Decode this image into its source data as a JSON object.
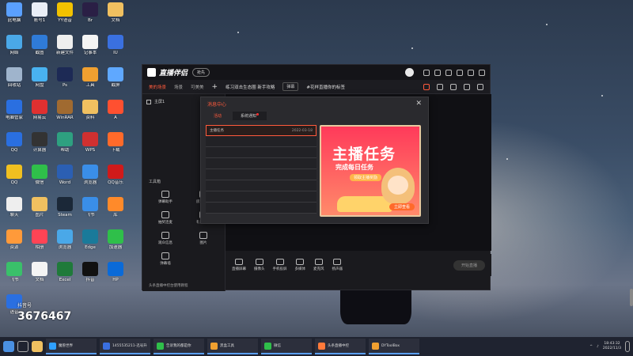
{
  "desktop_icons": [
    {
      "label": "此电脑",
      "color": "#5aa0ff"
    },
    {
      "label": "账号1",
      "color": "#e9eef7"
    },
    {
      "label": "YY语音",
      "color": "#f2c200"
    },
    {
      "label": "Br",
      "color": "#2a1f45"
    },
    {
      "label": "文档",
      "color": "#f0c060"
    },
    {
      "label": "网络",
      "color": "#4aa8e8"
    },
    {
      "label": "截图",
      "color": "#2f7bd8"
    },
    {
      "label": "新建文件",
      "color": "#eeeeee"
    },
    {
      "label": "记事本",
      "color": "#f4f4f4"
    },
    {
      "label": "IU",
      "color": "#3a70e0"
    },
    {
      "label": "回收站",
      "color": "#9fb4cc"
    },
    {
      "label": "网盘",
      "color": "#49b2f0"
    },
    {
      "label": "Ps",
      "color": "#1d2a55"
    },
    {
      "label": "工具",
      "color": "#f0a030"
    },
    {
      "label": "截屏",
      "color": "#5fa8ff"
    },
    {
      "label": "电脑管家",
      "color": "#2a6fe0"
    },
    {
      "label": "网易云",
      "color": "#e03030"
    },
    {
      "label": "WinRAR",
      "color": "#a06a30"
    },
    {
      "label": "资料",
      "color": "#f0c060"
    },
    {
      "label": "A",
      "color": "#ff5030"
    },
    {
      "label": "QQ",
      "color": "#2a6fe0"
    },
    {
      "label": "计算器",
      "color": "#333333"
    },
    {
      "label": "帮助",
      "color": "#2ea080"
    },
    {
      "label": "WPS",
      "color": "#d03030"
    },
    {
      "label": "下载",
      "color": "#ff6a2a"
    },
    {
      "label": "QQ",
      "color": "#f0c020"
    },
    {
      "label": "微信",
      "color": "#2fbf4a"
    },
    {
      "label": "Word",
      "color": "#2b5fb3"
    },
    {
      "label": "浏览器",
      "color": "#3a8ee8"
    },
    {
      "label": "QQ音乐",
      "color": "#d01a1a"
    },
    {
      "label": "聊天",
      "color": "#eeeeee"
    },
    {
      "label": "图片",
      "color": "#f0c060"
    },
    {
      "label": "Steam",
      "color": "#1b2838"
    },
    {
      "label": "飞书",
      "color": "#3a8ee8"
    },
    {
      "label": "库",
      "color": "#ff8a2a"
    },
    {
      "label": "资源",
      "color": "#ff9a3a"
    },
    {
      "label": "相册",
      "color": "#f45"
    },
    {
      "label": "浏览器",
      "color": "#4aa8e8"
    },
    {
      "label": "Edge",
      "color": "#1a7a9a"
    },
    {
      "label": "加速器",
      "color": "#2fbf4a"
    },
    {
      "label": "飞书",
      "color": "#3ac06a"
    },
    {
      "label": "文档",
      "color": "#f4f4f4"
    },
    {
      "label": "Excel",
      "color": "#1f7a3a"
    },
    {
      "label": "抖音",
      "color": "#111111"
    },
    {
      "label": "HP",
      "color": "#0a6ad8"
    },
    {
      "label": "语音",
      "color": "#2a6fe0"
    }
  ],
  "app": {
    "title": "直播伴侣",
    "version": "抢先",
    "tabs": [
      "美的场景",
      "场景",
      "可美美"
    ],
    "scene_name": "练习双击生态圈 新手攻略",
    "chip": "弹幕",
    "chip2": "#花样直播你的标签"
  },
  "left_panel": {
    "source_label": "主屏1",
    "tools_title": "工具箱",
    "tools": [
      "弹幕助手",
      "房管助手",
      "抽奖连麦",
      "礼物列表",
      "观众信息",
      "图片",
      "弹幕墙"
    ],
    "footer": "头条直播中控台使用教程"
  },
  "dialog": {
    "title": "消息中心",
    "tabs": [
      "活动",
      "系统通知"
    ],
    "list": [
      {
        "name": "主播任务",
        "date": "2022-03-18"
      }
    ],
    "banner_title": "主播任务",
    "banner_subtitle": "完成每日任务",
    "banner_pill": "领取主播奖励",
    "banner_button": "立即查看"
  },
  "bottom_bar": {
    "controls": [
      "直播屏幕",
      "摄像头",
      "手机投屏",
      "多媒体",
      "麦克风",
      "扬声器"
    ],
    "go_live": "开始直播"
  },
  "watermark": {
    "line1": "抖音号",
    "line2": "3676467"
  },
  "taskbar": {
    "apps": [
      "魔兽世界",
      "1455535211-迅号升",
      "告诉我的都是你",
      "黑盒工具",
      "微信",
      "头条直播中控",
      "DYToolBox"
    ],
    "time": "18:43:32",
    "date": "2022/11/3"
  }
}
